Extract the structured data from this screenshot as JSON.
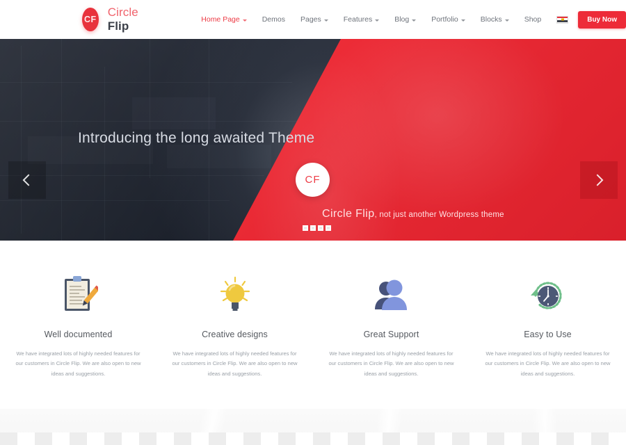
{
  "header": {
    "logo": {
      "initials": "CF",
      "name_part1": "Circle",
      "name_part2": "Flip"
    },
    "nav": [
      {
        "label": "Home Page",
        "has_caret": true,
        "active": true
      },
      {
        "label": "Demos",
        "has_caret": false,
        "active": false
      },
      {
        "label": "Pages",
        "has_caret": true,
        "active": false
      },
      {
        "label": "Features",
        "has_caret": true,
        "active": false
      },
      {
        "label": "Blog",
        "has_caret": true,
        "active": false
      },
      {
        "label": "Portfolio",
        "has_caret": true,
        "active": false
      },
      {
        "label": "Blocks",
        "has_caret": true,
        "active": false
      },
      {
        "label": "Shop",
        "has_caret": false,
        "active": false
      }
    ],
    "language_flag_icon": "egypt-flag-icon",
    "buy_button": "Buy Now"
  },
  "hero": {
    "title": "Introducing the long awaited Theme",
    "badge": "CF",
    "subtitle_brand": "Circle Flip",
    "subtitle_rest": ", not just another Wordpress theme",
    "prev_icon": "chevron-left-icon",
    "next_icon": "chevron-right-icon",
    "dots": 4,
    "active_dot": 0,
    "accent_color": "#ec2b36",
    "dark_color": "#262b36"
  },
  "features": [
    {
      "icon": "clipboard-pencil-icon",
      "title": "Well documented",
      "desc": "We have integrated lots of highly needed features for our customers in Circle Flip. We are also open to new ideas and suggestions."
    },
    {
      "icon": "lightbulb-icon",
      "title": "Creative designs",
      "desc": "We have integrated lots of highly needed features for our customers in Circle Flip. We are also open to new ideas and suggestions."
    },
    {
      "icon": "users-icon",
      "title": "Great Support",
      "desc": "We have integrated lots of highly needed features for our customers in Circle Flip. We are also open to new ideas and suggestions."
    },
    {
      "icon": "clock-history-icon",
      "title": "Easy to Use",
      "desc": "We have integrated lots of highly needed features for our customers in Circle Flip. We are also open to new ideas and suggestions."
    }
  ]
}
